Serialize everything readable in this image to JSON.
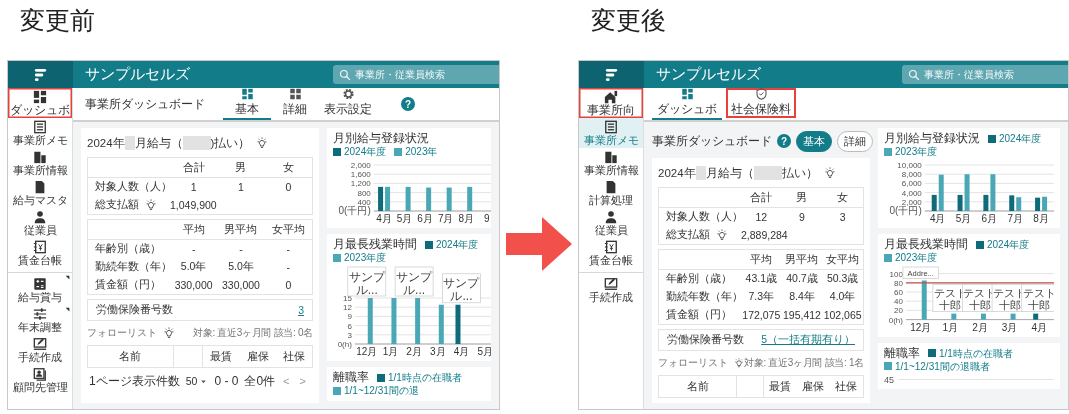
{
  "panels": [
    {
      "caption": "変更前",
      "screen": {
        "kind": "before",
        "app_title": "サンプルセルズ",
        "search": {
          "placeholder": "事業所・従業員検索"
        },
        "sidebar": [
          {
            "label": "ダッシュボ",
            "kind": "dashboard",
            "selected": false,
            "highlighted": true,
            "submenu": false,
            "divider_before": false
          },
          {
            "label": "事業所メモ",
            "kind": "memo",
            "selected": false,
            "highlighted": false,
            "submenu": false,
            "divider_before": false
          },
          {
            "label": "事業所情報",
            "kind": "building",
            "selected": false,
            "highlighted": false,
            "submenu": false,
            "divider_before": false
          },
          {
            "label": "給与マスタ",
            "kind": "document",
            "selected": false,
            "highlighted": false,
            "submenu": false,
            "divider_before": false
          },
          {
            "label": "従業員",
            "kind": "person",
            "selected": false,
            "highlighted": false,
            "submenu": false,
            "divider_before": false
          },
          {
            "label": "賃金台帳",
            "kind": "ledger",
            "selected": false,
            "highlighted": false,
            "submenu": false,
            "divider_before": false
          },
          {
            "label": "給与賞与",
            "kind": "calculator",
            "selected": false,
            "highlighted": false,
            "submenu": true,
            "divider_before": true
          },
          {
            "label": "年末調整",
            "kind": "sliders",
            "selected": false,
            "highlighted": false,
            "submenu": true,
            "divider_before": false
          },
          {
            "label": "手続作成",
            "kind": "form",
            "selected": false,
            "highlighted": false,
            "submenu": false,
            "divider_before": false
          },
          {
            "label": "顧問先管理",
            "kind": "client",
            "selected": false,
            "highlighted": false,
            "submenu": false,
            "divider_before": false
          }
        ],
        "page_title": "事業所ダッシュボード",
        "tabs": [
          {
            "label": "基本",
            "kind": "dashboard",
            "selected": true,
            "highlighted": false
          },
          {
            "label": "詳細",
            "kind": "tiles",
            "selected": false,
            "highlighted": false
          },
          {
            "label": "表示設定",
            "kind": "gear",
            "selected": false,
            "highlighted": false
          }
        ],
        "help": "?",
        "payroll": {
          "title_parts": [
            "2024年",
            "月給与（",
            ")払い）"
          ],
          "hint": true,
          "totals": {
            "columns": [
              "合計",
              "男",
              "女"
            ],
            "rows": [
              {
                "label": "対象人数（人）",
                "cells": [
                  "1",
                  "1",
                  "0"
                ]
              },
              {
                "label": "総支払額",
                "hint": true,
                "cells": [
                  "1,049,900"
                ]
              }
            ]
          },
          "averages": {
            "columns": [
              "平均",
              "男平均",
              "女平均"
            ],
            "rows": [
              {
                "label": "年齢別（歳）",
                "cells": [
                  "-",
                  "-",
                  "-"
                ]
              },
              {
                "label": "勤続年数（年）",
                "cells": [
                  "5.0年",
                  "5.0年",
                  "-"
                ]
              },
              {
                "label": "賃金額（円）",
                "cells": [
                  "330,000",
                  "330,000",
                  "0"
                ]
              }
            ]
          },
          "insurance": {
            "label": "労働保険番号数",
            "value": "3"
          }
        },
        "follow_list": {
          "title": "フォローリスト",
          "hint": true,
          "meta": "対象: 直近3ヶ月間 該当: 0名",
          "columns": [
            "名前",
            "最賃",
            "雇保",
            "社保"
          ]
        },
        "pagination": {
          "label": "1ページ表示件数",
          "page_size": "50",
          "range": "0 - 0",
          "total": "全0件",
          "prev": "<",
          "next": ">"
        },
        "charts": [
          {
            "kind": "chart",
            "chart_data": {
              "type": "bar",
              "title": "月別給与登録状況",
              "legend": "top",
              "grid": true,
              "categories": [
                "4月",
                "5月",
                "6月",
                "7月",
                "8月",
                "9"
              ],
              "ylim": [
                0,
                2000
              ],
              "yticks": [
                {
                  "value": 0,
                  "label": "0(千円)"
                },
                {
                  "value": 400,
                  "label": "400"
                },
                {
                  "value": 800,
                  "label": "800"
                },
                {
                  "value": 1200,
                  "label": "1,200"
                },
                {
                  "value": 1600,
                  "label": "1,600"
                },
                {
                  "value": 2000,
                  "label": "2,000"
                }
              ],
              "series": [
                {
                  "name": "2024年度",
                  "color": "#0d6b7a",
                  "values": [
                    1050,
                    null,
                    null,
                    null,
                    null,
                    null
                  ]
                },
                {
                  "name": "2023年",
                  "color": "#4aa8b6",
                  "values": [
                    1050,
                    1050,
                    1020,
                    1020,
                    1050,
                    null
                  ]
                }
              ]
            }
          },
          {
            "kind": "chart",
            "chart_data": {
              "type": "bar",
              "title": "月最長残業時間",
              "legend": "top",
              "grid": true,
              "categories": [
                "12月",
                "1月",
                "2月",
                "3月",
                "4月",
                "5月"
              ],
              "ylim": [
                0,
                15
              ],
              "yticks": [
                {
                  "value": 0,
                  "label": "0(h)"
                },
                {
                  "value": 3,
                  "label": "3"
                },
                {
                  "value": 6,
                  "label": "6"
                },
                {
                  "value": 9,
                  "label": "9"
                },
                {
                  "value": 12,
                  "label": "12"
                },
                {
                  "value": 15,
                  "label": "15"
                }
              ],
              "series": [
                {
                  "name": "2024年度",
                  "color": "#0d6b7a",
                  "values": [
                    null,
                    null,
                    null,
                    null,
                    12.8,
                    null
                  ]
                },
                {
                  "name": "2023年度",
                  "color": "#4aa8b6",
                  "values": [
                    15,
                    15,
                    15,
                    12.8,
                    null,
                    null
                  ]
                }
              ],
              "annotations": [
                {
                  "x": "12月",
                  "y": 15,
                  "text": "サンプル..."
                },
                {
                  "x": "2月",
                  "y": 15,
                  "text": "サンプル..."
                },
                {
                  "x": "4月",
                  "y": 12.8,
                  "text": "サンプル..."
                }
              ]
            }
          },
          {
            "kind": "legend_panel",
            "title": "離職率",
            "legend": [
              {
                "label": "1/1時点の在職者",
                "color": "#0d6b7a"
              },
              {
                "label": "1/1~12/31間の退",
                "color": "#4aa8b6"
              }
            ]
          }
        ]
      }
    },
    {
      "caption": "変更後",
      "screen": {
        "kind": "after",
        "app_title": "サンプルセルズ",
        "search": {
          "placeholder": "事業所・従業員検索"
        },
        "sidebar": [
          {
            "label": "事業所向",
            "kind": "home",
            "selected": false,
            "highlighted": true,
            "submenu": false,
            "divider_before": false
          },
          {
            "label": "事業所メモ",
            "kind": "memo",
            "selected": true,
            "highlighted": false,
            "submenu": false,
            "divider_before": false
          },
          {
            "label": "事業所情報",
            "kind": "building",
            "selected": false,
            "highlighted": false,
            "submenu": false,
            "divider_before": false
          },
          {
            "label": "計算処理",
            "kind": "document",
            "selected": false,
            "highlighted": false,
            "submenu": false,
            "divider_before": false
          },
          {
            "label": "従業員",
            "kind": "person",
            "selected": false,
            "highlighted": false,
            "submenu": false,
            "divider_before": false
          },
          {
            "label": "賃金台帳",
            "kind": "ledger",
            "selected": false,
            "highlighted": false,
            "submenu": false,
            "divider_before": false
          },
          {
            "label": "手続作成",
            "kind": "form",
            "selected": false,
            "highlighted": false,
            "submenu": false,
            "divider_before": true
          }
        ],
        "tabs": [
          {
            "label": "ダッシュボ",
            "kind": "dashboard",
            "selected": true,
            "highlighted": false
          },
          {
            "label": "社会保険料",
            "kind": "shield",
            "selected": false,
            "highlighted": true
          }
        ],
        "page_title": "事業所ダッシュボード",
        "help": "?",
        "view_buttons": [
          {
            "label": "基本",
            "selected": true
          },
          {
            "label": "詳細",
            "selected": false
          }
        ],
        "payroll": {
          "title_parts": [
            "2024年",
            "月給与（",
            "払い）"
          ],
          "hint": true,
          "totals": {
            "columns": [
              "合計",
              "男",
              "女"
            ],
            "rows": [
              {
                "label": "対象人数（人）",
                "cells": [
                  "12",
                  "9",
                  "3"
                ]
              },
              {
                "label": "総支払額",
                "hint": true,
                "cells": [
                  "2,889,284"
                ]
              }
            ]
          },
          "averages": {
            "columns": [
              "平均",
              "男平均",
              "女平均"
            ],
            "rows": [
              {
                "label": "年齢別（歳）",
                "cells": [
                  "43.1歳",
                  "40.7歳",
                  "50.3歳"
                ]
              },
              {
                "label": "勤続年数（年）",
                "cells": [
                  "7.3年",
                  "8.4年",
                  "4.0年"
                ]
              },
              {
                "label": "賃金額（円）",
                "cells": [
                  "172,075",
                  "195,412",
                  "102,065"
                ]
              }
            ]
          },
          "insurance": {
            "label": "労働保険番号数",
            "value": "5（一括有期有り）"
          }
        },
        "follow_list": {
          "title": "フォローリスト",
          "hint": true,
          "meta": "対象: 直近3ヶ月間 該当: 1名",
          "columns": [
            "名前",
            "最賃",
            "雇保",
            "社保"
          ]
        },
        "charts": [
          {
            "kind": "chart",
            "chart_data": {
              "type": "bar",
              "title": "月別給与登録状況",
              "legend": "top",
              "grid": true,
              "categories": [
                "4月",
                "5月",
                "6月",
                "7月",
                "8月"
              ],
              "ylim": [
                0,
                10000
              ],
              "yticks": [
                {
                  "value": 0,
                  "label": "0(千円)"
                },
                {
                  "value": 2000,
                  "label": "2,000"
                },
                {
                  "value": 4000,
                  "label": "4,000"
                },
                {
                  "value": 6000,
                  "label": "6,000"
                },
                {
                  "value": 8000,
                  "label": "8,000"
                },
                {
                  "value": 10000,
                  "label": "10,000"
                }
              ],
              "series": [
                {
                  "name": "2024年度",
                  "color": "#0d6b7a",
                  "values": [
                    3500,
                    3500,
                    3500,
                    3400,
                    2900
                  ]
                },
                {
                  "name": "2023年度",
                  "color": "#4aa8b6",
                  "values": [
                    7900,
                    8000,
                    8000,
                    3000,
                    3100
                  ]
                }
              ]
            }
          },
          {
            "kind": "chart",
            "chart_data": {
              "type": "bar",
              "title": "月最長残業時間",
              "legend": "top",
              "grid": true,
              "categories": [
                "12月",
                "1月",
                "2月",
                "3月",
                "4月"
              ],
              "ylim": [
                0,
                100
              ],
              "yticks": [
                {
                  "value": 0,
                  "label": "0(h)"
                },
                {
                  "value": 20,
                  "label": "20"
                },
                {
                  "value": 40,
                  "label": "40"
                },
                {
                  "value": 60,
                  "label": "60"
                },
                {
                  "value": 80,
                  "label": "80"
                },
                {
                  "value": 100,
                  "label": "100"
                }
              ],
              "series": [
                {
                  "name": "2024年度",
                  "color": "#0d6b7a",
                  "values": [
                    null,
                    null,
                    null,
                    null,
                    13
                  ]
                },
                {
                  "name": "2023年度",
                  "color": "#4aa8b6",
                  "values": [
                    85,
                    13,
                    13,
                    13,
                    null
                  ]
                }
              ],
              "ref_lines": [
                {
                  "axis": "y",
                  "value": 80,
                  "color": "#c0504d"
                }
              ],
              "annotations": [
                {
                  "x": "12月",
                  "y": 85,
                  "text": "Addre..."
                },
                {
                  "x": "1月",
                  "y": 13,
                  "text": "テスト十郎"
                },
                {
                  "x": "2月",
                  "y": 13,
                  "text": "テスト十郎"
                },
                {
                  "x": "3月",
                  "y": 13,
                  "text": "テスト十郎"
                },
                {
                  "x": "4月",
                  "y": 13,
                  "text": "テスト十郎"
                }
              ]
            }
          },
          {
            "kind": "legend_panel",
            "title": "離職率",
            "legend": [
              {
                "label": "1/1時点の在職者",
                "color": "#0d6b7a"
              },
              {
                "label": "1/1~12/31間の退職者",
                "color": "#4aa8b6"
              }
            ],
            "axis_tick": "45"
          }
        ]
      }
    }
  ]
}
